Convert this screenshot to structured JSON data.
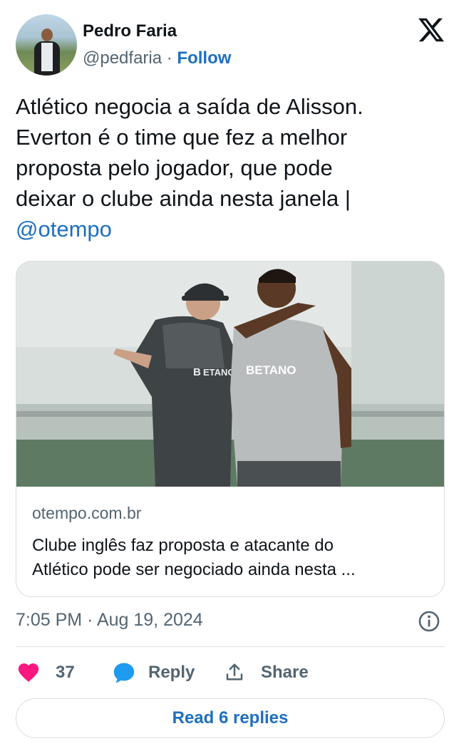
{
  "author": {
    "name": "Pedro Faria",
    "handle": "@pedfaria",
    "separator": " · ",
    "follow_label": "Follow"
  },
  "brand": {
    "logo_icon": "x-logo-icon"
  },
  "tweet": {
    "lines": [
      "Atlético negocia a saída de Alisson.",
      "Everton é o time que fez a melhor",
      "proposta pelo jogador, que pode",
      "deixar o clube ainda nesta janela |"
    ],
    "mention": "@otempo"
  },
  "card": {
    "domain": "otempo.com.br",
    "title_lines": [
      "Clube inglês faz proposta e atacante do",
      "Atlético pode ser negociado ainda nesta ..."
    ],
    "image_sponsor_text": "BETANO"
  },
  "meta": {
    "timestamp": "7:05 PM · Aug 19, 2024"
  },
  "actions": {
    "like_count": "37",
    "reply_label": "Reply",
    "share_label": "Share"
  },
  "read_replies_label": "Read 6 replies",
  "colors": {
    "accent": "#1d6fc0",
    "like": "#f91880",
    "reply_bubble": "#1d9bf0",
    "secondary_text": "#536471"
  }
}
